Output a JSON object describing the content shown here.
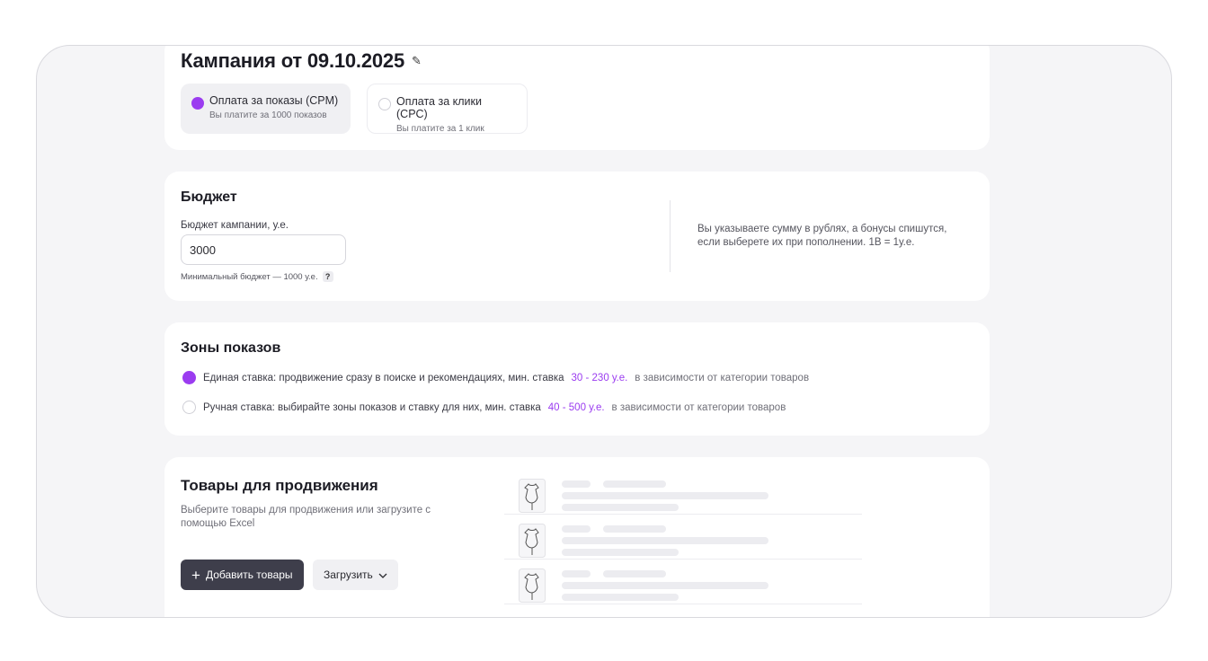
{
  "campaign": {
    "title": "Кампания от 09.10.2025",
    "payment_options": [
      {
        "title": "Оплата за показы (CPM)",
        "subtitle": "Вы платите за 1000 показов",
        "selected": true
      },
      {
        "title": "Оплата за клики (CPC)",
        "subtitle": "Вы платите за 1 клик",
        "selected": false
      }
    ]
  },
  "budget": {
    "heading": "Бюджет",
    "field_label": "Бюджет кампании, у.е.",
    "value": "3000",
    "hint": "Минимальный бюджет — 1000 у.е.",
    "hint_icon": "?",
    "note": "Вы указываете сумму в рублях, а бонусы спишутся, если выберете их при пополнении. 1В = 1у.е."
  },
  "zones": {
    "heading": "Зоны показов",
    "options": [
      {
        "text": "Единая ставка: продвижение сразу в поиске и рекомендациях, мин. ставка",
        "range": "30 - 230 у.е.",
        "suffix": "в зависимости от категории товаров",
        "selected": true
      },
      {
        "text": "Ручная ставка: выбирайте зоны показов и ставку для них, мин. ставка",
        "range": "40 - 500 у.е.",
        "suffix": "в зависимости от категории товаров",
        "selected": false
      }
    ]
  },
  "products": {
    "heading": "Товары для продвижения",
    "subtitle": "Выберите товары для продвижения или загрузите с помощью Excel",
    "add_button": "Добавить товары",
    "upload_button": "Загрузить",
    "placeholder_rows": 3
  },
  "colors": {
    "accent": "#9b3cf0",
    "dark_button": "#3e3e4b"
  },
  "icons": {
    "edit": "pencil-icon",
    "plus": "plus-icon",
    "chevron": "chevron-down-icon",
    "product": "dress-icon"
  }
}
